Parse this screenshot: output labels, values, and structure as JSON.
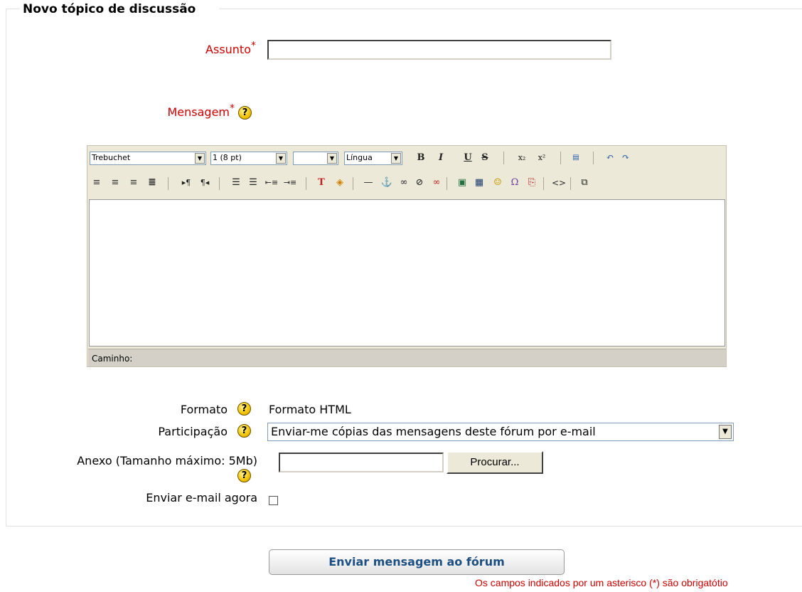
{
  "legend": "Novo tópico de discussão",
  "subject": {
    "label": "Assunto",
    "required_mark": "*",
    "value": ""
  },
  "message": {
    "label": "Mensagem",
    "required_mark": "*",
    "help": "?"
  },
  "editor": {
    "font_family": "Trebuchet",
    "font_size": "1 (8 pt)",
    "heading": "",
    "language": "Língua",
    "path_label": "Caminho:",
    "buttons_row1": [
      "bold-icon",
      "italic-icon",
      "underline-icon",
      "strikethrough-icon",
      "subscript-icon",
      "superscript-icon",
      "paste-word-icon",
      "undo-icon",
      "redo-icon"
    ],
    "buttons_row2": [
      "align-left-icon",
      "align-center-icon",
      "align-right-icon",
      "justify-icon",
      "ltr-icon",
      "rtl-icon",
      "ordered-list-icon",
      "unordered-list-icon",
      "outdent-icon",
      "indent-icon",
      "text-color-icon",
      "background-color-icon",
      "horizontal-rule-icon",
      "anchor-icon",
      "link-icon",
      "unlink-icon",
      "nolink-icon",
      "image-icon",
      "table-icon",
      "smiley-icon",
      "special-char-icon",
      "search-replace-icon",
      "html-source-icon",
      "fullscreen-icon"
    ]
  },
  "format": {
    "label": "Formato",
    "help": "?",
    "value": "Formato HTML"
  },
  "participation": {
    "label": "Participação",
    "help": "?",
    "selected": "Enviar-me cópias das mensagens deste fórum por e-mail"
  },
  "attachment": {
    "label": "Anexo (Tamanho máximo: 5Mb)",
    "help": "?",
    "browse_label": "Procurar..."
  },
  "email_now": {
    "label": "Enviar e-mail agora",
    "checked": false
  },
  "submit_label": "Enviar mensagem ao fórum",
  "required_note": "Os campos indicados por um asterisco (*) são obrigatótio",
  "colors": {
    "required": "#cc0000",
    "submit_text": "#1d4f82",
    "editor_bg": "#ece9d8"
  }
}
